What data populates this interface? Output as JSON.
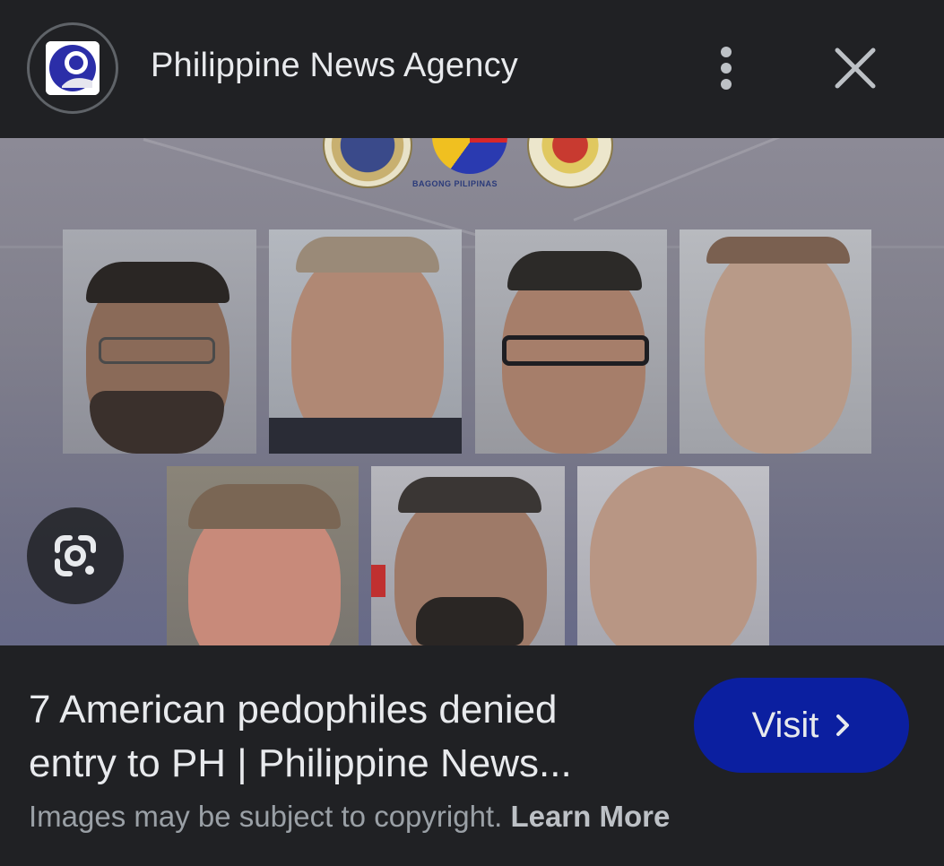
{
  "header": {
    "source_name": "Philippine News Agency"
  },
  "image": {
    "logo_caption": "BAGONG PILIPINAS",
    "photo_count": 7
  },
  "result": {
    "title_line1": "7 American pedophiles denied",
    "title_line2": "entry to PH | Philippine News...",
    "visit_label": "Visit",
    "copyright_text": "Images may be subject to copyright.",
    "learn_more_label": "Learn More"
  },
  "colors": {
    "background": "#202124",
    "visit_button": "#0b1fa0",
    "text_primary": "#e8eaed",
    "text_secondary": "#9aa0a6"
  },
  "icons": {
    "more": "more-vert-icon",
    "close": "close-icon",
    "lens": "google-lens-icon"
  }
}
